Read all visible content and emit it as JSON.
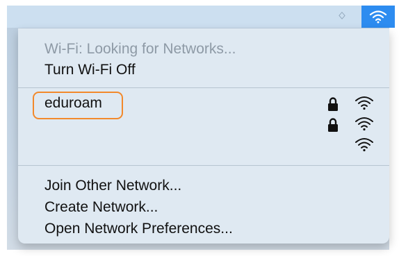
{
  "menubar": {
    "icons": [
      "bluetooth-icon",
      "wifi-status-icon"
    ],
    "active_color": "#2d8cf0"
  },
  "wifi_menu": {
    "status": "Wi-Fi: Looking for Networks...",
    "toggle_label": "Turn Wi-Fi Off",
    "networks": [
      {
        "name": "eduroam",
        "secured": true,
        "icons": [
          "lock-icon",
          "wifi-signal-icon"
        ]
      },
      {
        "name": "",
        "secured": true,
        "icons": [
          "lock-icon",
          "wifi-signal-icon"
        ]
      },
      {
        "name": "",
        "secured": false,
        "icons": [
          "wifi-signal-icon"
        ]
      }
    ],
    "actions": [
      "Join Other Network...",
      "Create Network...",
      "Open Network Preferences..."
    ],
    "highlight_color": "#f2892b"
  }
}
